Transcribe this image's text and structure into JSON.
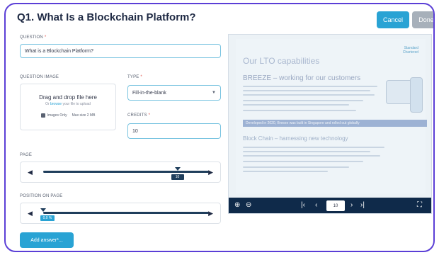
{
  "header": {
    "title": "Q1. What Is a Blockchain Platform?",
    "cancel_label": "Cancel",
    "done_label": "Done"
  },
  "form": {
    "question": {
      "label": "QUESTION",
      "value": "What is a Blockchain Platform?"
    },
    "question_image": {
      "label": "QUESTION IMAGE",
      "main_text": "Drag and drop file here",
      "sub_prefix": "Or",
      "sub_link": "browse",
      "sub_suffix": "your file to upload",
      "hint_images": "Images Only",
      "hint_size": "Max size 2 MB"
    },
    "type": {
      "label": "TYPE",
      "value": "Fill-in-the-blank"
    },
    "credits": {
      "label": "CREDITS",
      "value": "10"
    },
    "page": {
      "label": "PAGE",
      "value": "10",
      "fraction": 0.81
    },
    "position": {
      "label": "POSITION ON PAGE",
      "value": "0.0 %",
      "fraction": 0.0
    },
    "add_answer_label": "Add answer*..."
  },
  "viewer": {
    "page_title": "Our LTO capabilities",
    "section1": "BREEZE – working for our customers",
    "banner": "Developed in 2020, Breeze was built in Singapore and rolled out globally",
    "section2": "Block Chain – harnessing new technology",
    "logo_line1": "Standard",
    "logo_line2": "Chartered",
    "page_number": "10"
  },
  "colors": {
    "accent": "#29a3d4",
    "frame": "#5b3fd6",
    "navy": "#0f2a4a",
    "disabled": "#a7b0ba"
  },
  "icons": {
    "zoom_in": "zoom-in-icon",
    "zoom_out": "zoom-out-icon",
    "first": "first-page-icon",
    "prev": "previous-page-icon",
    "next": "next-page-icon",
    "last": "last-page-icon",
    "fullscreen": "fullscreen-icon"
  }
}
